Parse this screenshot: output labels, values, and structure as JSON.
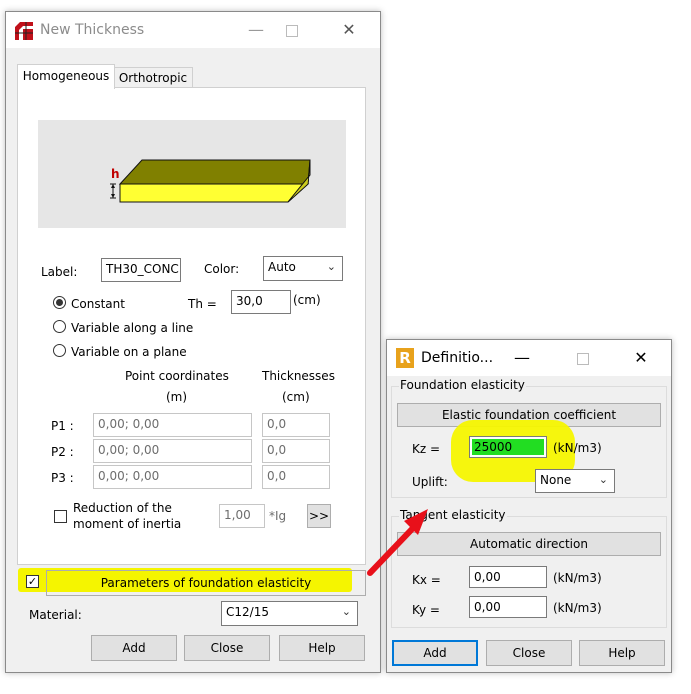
{
  "main_window": {
    "title": "New Thickness",
    "tabs": [
      {
        "label": "Homogeneous"
      },
      {
        "label": "Orthotropic"
      }
    ],
    "preview_h_label": "h",
    "label_caption": "Label:",
    "label_value": "TH30_CONC",
    "color_caption": "Color:",
    "color_value": "Auto",
    "mode_options": [
      {
        "label": "Constant",
        "selected": true
      },
      {
        "label": "Variable along a line",
        "selected": false
      },
      {
        "label": "Variable on a plane",
        "selected": false
      }
    ],
    "th_caption": "Th =",
    "th_value": "30,0",
    "th_unit": "(cm)",
    "point_coords_header": "Point coordinates",
    "point_coords_unit": "(m)",
    "thickness_header": "Thicknesses",
    "thickness_unit": "(cm)",
    "points": [
      {
        "label": "P1 :",
        "coords": "0,00; 0,00",
        "thickness": "0,0"
      },
      {
        "label": "P2 :",
        "coords": "0,00; 0,00",
        "thickness": "0,0"
      },
      {
        "label": "P3 :",
        "coords": "0,00; 0,00",
        "thickness": "0,0"
      }
    ],
    "reduction_label_1": "Reduction of the",
    "reduction_label_2": "moment of inertia",
    "reduction_value": "1,00",
    "reduction_unit": "*Ig",
    "more_button": ">>",
    "foundation_check_mark": "✓",
    "foundation_button": "Parameters of foundation elasticity",
    "material_caption": "Material:",
    "material_value": "C12/15",
    "buttons": {
      "add": "Add",
      "close": "Close",
      "help": "Help"
    }
  },
  "definition_window": {
    "title": "Definitio...",
    "group_foundation": "Foundation elasticity",
    "elastic_button": "Elastic foundation coefficient",
    "kz_caption": "Kz =",
    "kz_value": "25000",
    "kz_unit": "(kN/m3)",
    "uplift_caption": "Uplift:",
    "uplift_value": "None",
    "group_tangent": "Tangent elasticity",
    "auto_button": "Automatic direction",
    "kx_caption": "Kx =",
    "kx_value": "0,00",
    "kx_unit": "(kN/m3)",
    "ky_caption": "Ky =",
    "ky_value": "0,00",
    "ky_unit": "(kN/m3)",
    "buttons": {
      "add": "Add",
      "close": "Close",
      "help": "Help"
    }
  },
  "colors": {
    "highlight": "#f5f500",
    "arrow": "#e8101a",
    "kz_field": "#22dd22",
    "accent": "#0078d7"
  }
}
